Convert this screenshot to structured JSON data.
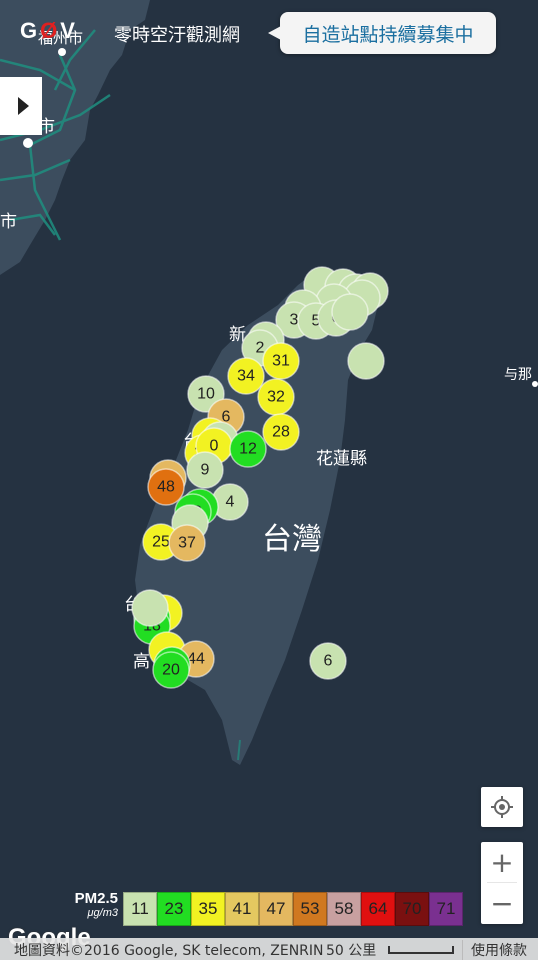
{
  "header": {
    "logo_text": "G",
    "logo_slash": "Ø",
    "logo_end": "V",
    "subtitle": "零時空汙觀測網",
    "banner": "自造站點持續募集中"
  },
  "map": {
    "labels": {
      "island": "台灣",
      "hualien": "花蓮縣",
      "yonaguni": "与那",
      "taichung_cut": "台",
      "hsinchu_cut": "新",
      "kaohsiung_cut": "高",
      "taichung2_cut": "台中",
      "fuzhou_cut": "福州市",
      "putian_cut": "市",
      "nanping_cut": "市"
    },
    "markers": [
      {
        "label": "",
        "color": "#c8e2b0"
      },
      {
        "label": "",
        "color": "#c8e2b0"
      },
      {
        "label": "",
        "color": "#c8e2b0"
      },
      {
        "label": "",
        "color": "#c8e2b0"
      },
      {
        "label": "",
        "color": "#c8e2b0"
      },
      {
        "label": "",
        "color": "#c8e2b0"
      },
      {
        "label": "",
        "color": "#c8e2b0"
      },
      {
        "label": "3",
        "color": "#c8e2b0"
      },
      {
        "label": "5",
        "color": "#c8e2b0"
      },
      {
        "label": "6",
        "color": "#c8e2b0"
      },
      {
        "label": "",
        "color": "#c8e2b0"
      },
      {
        "label": "",
        "color": "#c8e2b0"
      },
      {
        "label": "2",
        "color": "#c8e2b0"
      },
      {
        "label": "31",
        "color": "#f2f222"
      },
      {
        "label": "34",
        "color": "#f2f222"
      },
      {
        "label": "",
        "color": "#c8e2b0"
      },
      {
        "label": "32",
        "color": "#f2f222"
      },
      {
        "label": "10",
        "color": "#c8e2b0"
      },
      {
        "label": "6",
        "color": "#e4b860"
      },
      {
        "label": "28",
        "color": "#f2f222"
      },
      {
        "label": "",
        "color": "#f2f222"
      },
      {
        "label": "",
        "color": "#c8e2b0"
      },
      {
        "label": "35",
        "color": "#f2f222"
      },
      {
        "label": "0",
        "color": "#f2f222"
      },
      {
        "label": "12",
        "color": "#22dd22"
      },
      {
        "label": "9",
        "color": "#c8e2b0"
      },
      {
        "label": "",
        "color": "#e4b860"
      },
      {
        "label": "48",
        "color": "#e07010"
      },
      {
        "label": "4",
        "color": "#c8e2b0"
      },
      {
        "label": "",
        "color": "#22dd22"
      },
      {
        "label": "18",
        "color": "#22dd22"
      },
      {
        "label": "",
        "color": "#c8e2b0"
      },
      {
        "label": "25",
        "color": "#f2f222"
      },
      {
        "label": "37",
        "color": "#e4b860"
      },
      {
        "label": "",
        "color": "#f2f222"
      },
      {
        "label": "3",
        "color": "#f2f222"
      },
      {
        "label": "",
        "color": "#22dd22"
      },
      {
        "label": "18",
        "color": "#22dd22"
      },
      {
        "label": "",
        "color": "#f2f222"
      },
      {
        "label": "44",
        "color": "#e4b860"
      },
      {
        "label": "",
        "color": "#22dd22"
      },
      {
        "label": "20",
        "color": "#22dd22"
      },
      {
        "label": "6",
        "color": "#c8e2b0"
      },
      {
        "label": "",
        "color": "#c8e2b0"
      }
    ]
  },
  "controls": {
    "locate_icon": "crosshair-icon",
    "zoom_in": "+",
    "zoom_out": "−",
    "toggle_icon": "play-right-icon"
  },
  "legend": {
    "title": "PM2.5",
    "unit": "μg/m3",
    "levels": [
      {
        "value": "11",
        "color": "#c8e2b0"
      },
      {
        "value": "23",
        "color": "#22dd22"
      },
      {
        "value": "35",
        "color": "#f2f222"
      },
      {
        "value": "41",
        "color": "#e4c860"
      },
      {
        "value": "47",
        "color": "#e4b860"
      },
      {
        "value": "53",
        "color": "#d07820"
      },
      {
        "value": "58",
        "color": "#c8a0a0"
      },
      {
        "value": "64",
        "color": "#e01010"
      },
      {
        "value": "70",
        "color": "#7a1010"
      },
      {
        "value": "71",
        "color": "#7a3090"
      }
    ]
  },
  "footer": {
    "google": "Google",
    "attribution": "地圖資料©2016 Google, SK telecom, ZENRIN",
    "scale": "50 公里",
    "terms": "使用條款"
  }
}
